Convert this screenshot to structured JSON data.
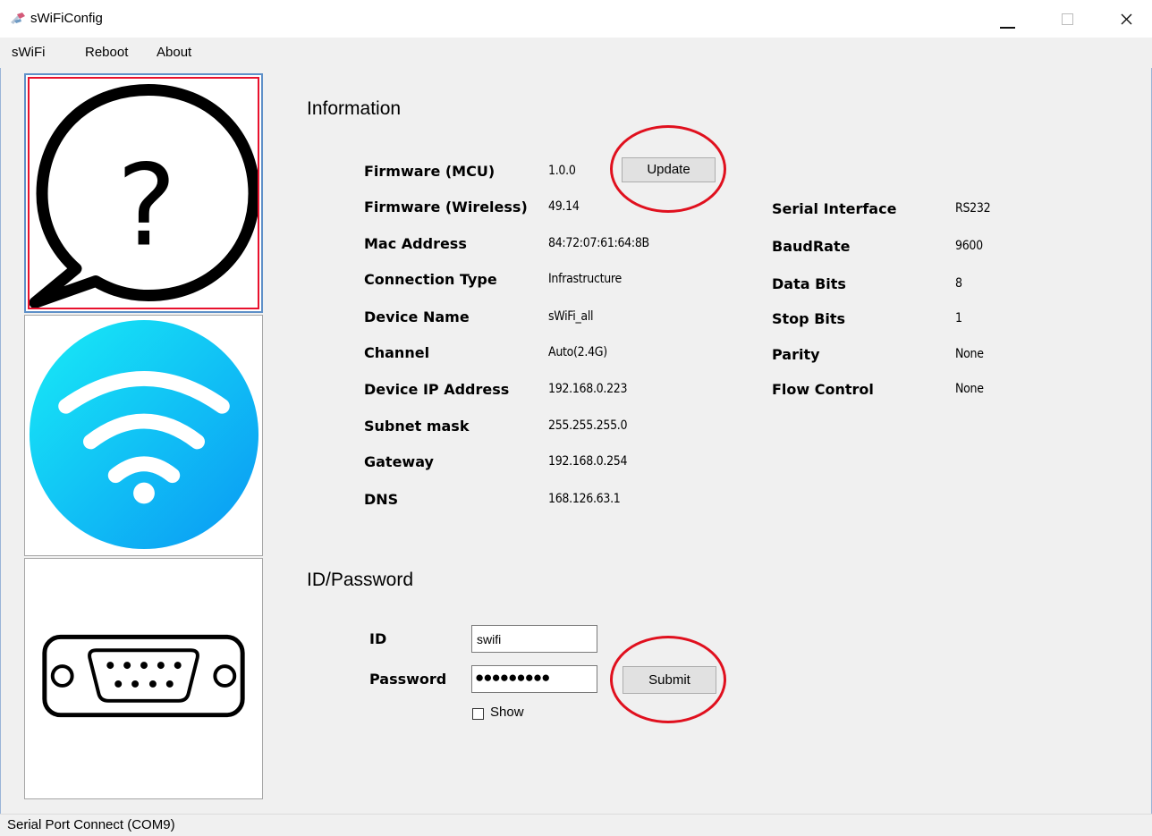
{
  "window": {
    "title": "sWiFiConfig"
  },
  "menu": [
    "sWiFi",
    "Reboot",
    "About"
  ],
  "sidebar": {
    "tiles": [
      {
        "name": "information",
        "icon": "question-bubble-icon",
        "selected": true
      },
      {
        "name": "wifi",
        "icon": "wifi-icon",
        "selected": false
      },
      {
        "name": "serial",
        "icon": "serial-port-icon",
        "selected": false
      }
    ],
    "info_question_mark": "?"
  },
  "information": {
    "title": "Information",
    "left_rows": [
      {
        "label": "Firmware (MCU)",
        "value": "1.0.0"
      },
      {
        "label": "Firmware (Wireless)",
        "value": "49.14"
      },
      {
        "label": "Mac Address",
        "value": "84:72:07:61:64:8B"
      },
      {
        "label": "Connection Type",
        "value": "Infrastructure"
      },
      {
        "label": "Device Name",
        "value": "sWiFi_all"
      },
      {
        "label": "Channel",
        "value": "Auto(2.4G)"
      },
      {
        "label": "Device IP Address",
        "value": "192.168.0.223"
      },
      {
        "label": "Subnet mask",
        "value": "255.255.255.0"
      },
      {
        "label": "Gateway",
        "value": "192.168.0.254"
      },
      {
        "label": "DNS",
        "value": "168.126.63.1"
      }
    ],
    "right_rows": [
      {
        "label": "Serial Interface",
        "value": "RS232"
      },
      {
        "label": "BaudRate",
        "value": "9600"
      },
      {
        "label": "Data Bits",
        "value": "8"
      },
      {
        "label": "Stop Bits",
        "value": "1"
      },
      {
        "label": "Parity",
        "value": "None"
      },
      {
        "label": "Flow Control",
        "value": "None"
      }
    ],
    "update_button": "Update"
  },
  "credentials": {
    "title": "ID/Password",
    "id_label": "ID",
    "id_value": "swifi",
    "password_label": "Password",
    "password_mask": "●●●●●●●●●",
    "show_label": "Show",
    "show_checked": false,
    "submit_button": "Submit"
  },
  "status": {
    "text": "Serial Port Connect (COM9)"
  },
  "colors": {
    "highlight": "#e0101e",
    "selected_tile_border": "#5e90c8",
    "wifi_gradient_start": "#14e1f5",
    "wifi_gradient_end": "#0d9ff5"
  }
}
